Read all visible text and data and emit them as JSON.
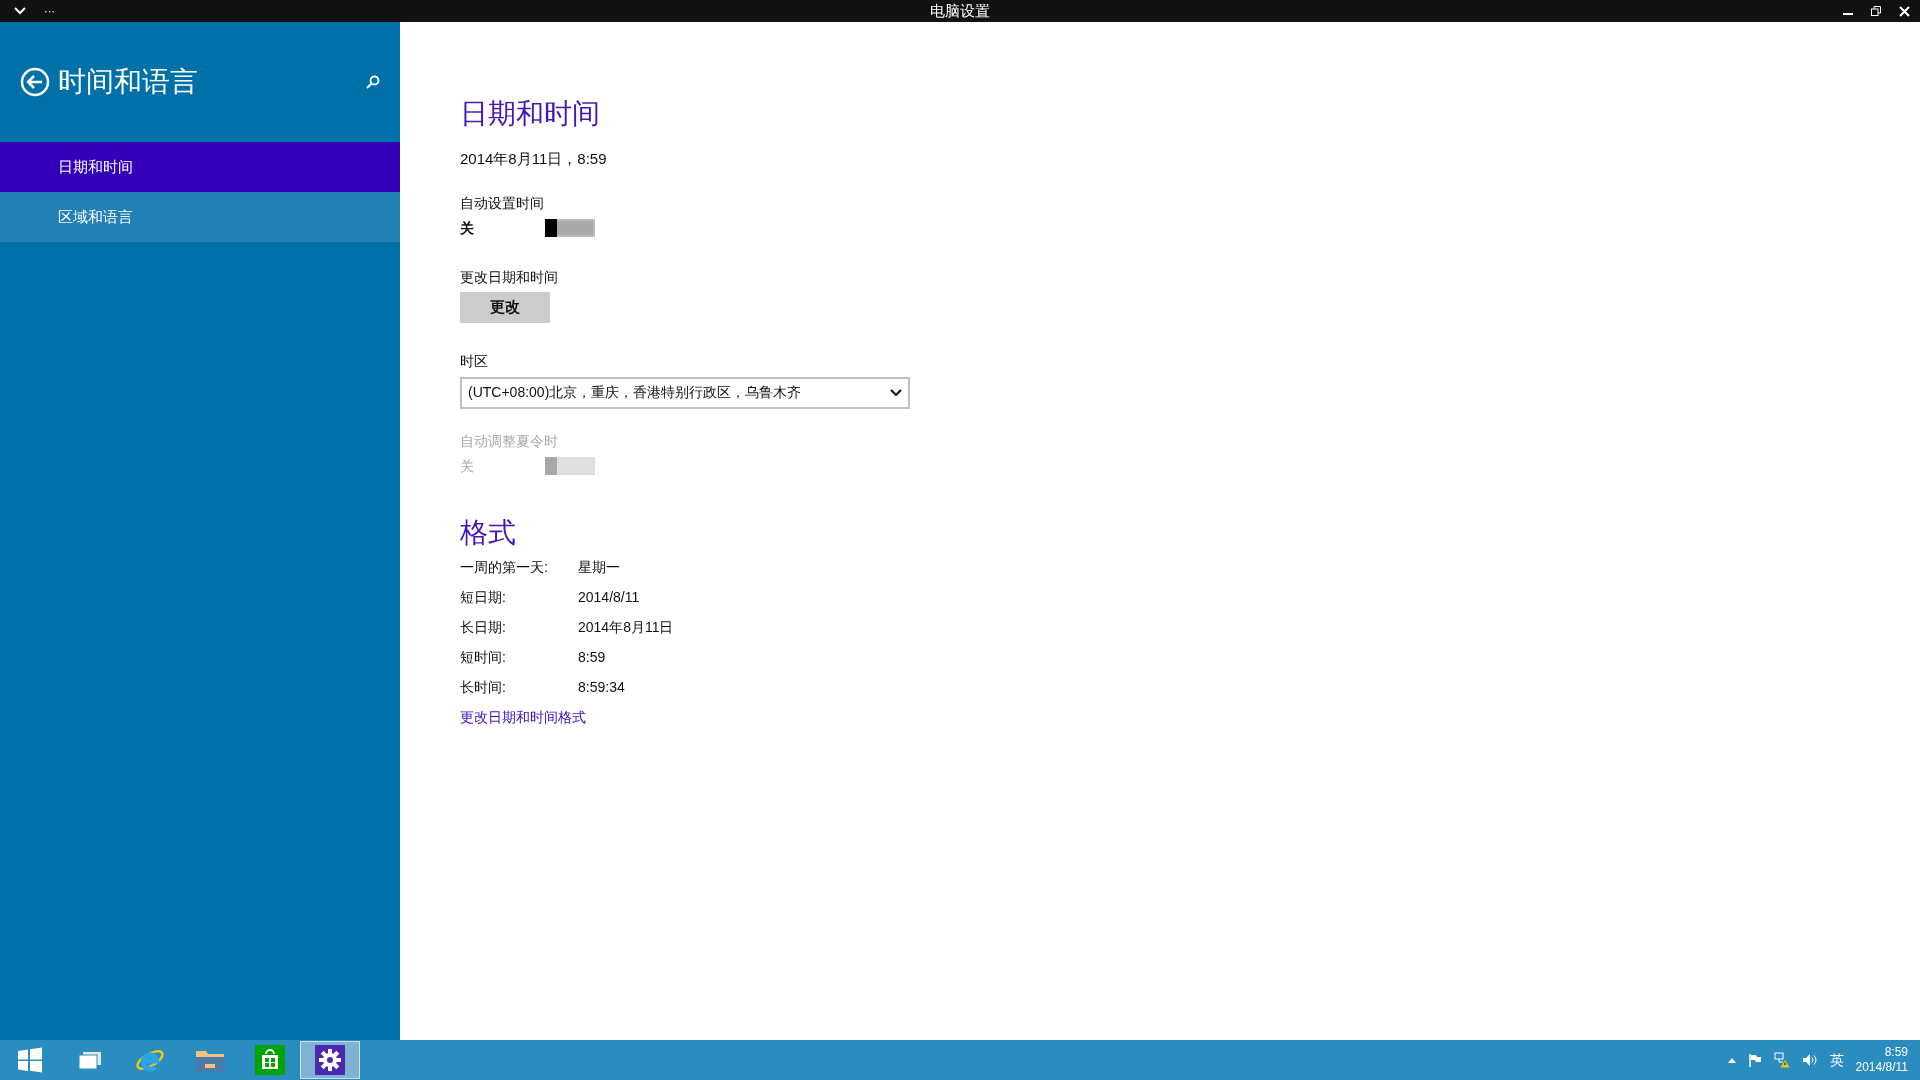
{
  "window": {
    "title": "电脑设置",
    "menu": "···"
  },
  "sidebar": {
    "title": "时间和语言",
    "items": [
      {
        "label": "日期和时间",
        "selected": true
      },
      {
        "label": "区域和语言",
        "selected": false
      }
    ]
  },
  "content": {
    "heading": "日期和时间",
    "current": "2014年8月11日，8:59",
    "settings": [
      {
        "kind": "toggle",
        "label": "自动设置时间",
        "state_text": "关",
        "on": false,
        "disabled": false
      },
      {
        "kind": "button",
        "label": "更改日期和时间",
        "button": "更改"
      },
      {
        "kind": "dropdown",
        "label": "时区",
        "value": "(UTC+08:00)北京，重庆，香港特别行政区，乌鲁木齐"
      },
      {
        "kind": "toggle",
        "label": "自动调整夏令时",
        "state_text": "关",
        "on": false,
        "disabled": true
      }
    ],
    "format": {
      "heading": "格式",
      "rows": [
        {
          "label": "一周的第一天:",
          "value": "星期一"
        },
        {
          "label": "短日期:",
          "value": "2014/8/11"
        },
        {
          "label": "长日期:",
          "value": "2014年8月11日"
        },
        {
          "label": "短时间:",
          "value": "8:59"
        },
        {
          "label": "长时间:",
          "value": "8:59:34"
        }
      ],
      "link": "更改日期和时间格式"
    }
  },
  "taskbar": {
    "apps": [
      {
        "kind": "start",
        "selected": false
      },
      {
        "kind": "taskview",
        "selected": false
      },
      {
        "kind": "browser",
        "selected": false
      },
      {
        "kind": "explorer",
        "selected": false
      },
      {
        "kind": "store",
        "selected": false
      },
      {
        "kind": "settings",
        "selected": true
      }
    ],
    "tray": {
      "language": "英",
      "time": "8:59",
      "date": "2014/8/11"
    }
  }
}
